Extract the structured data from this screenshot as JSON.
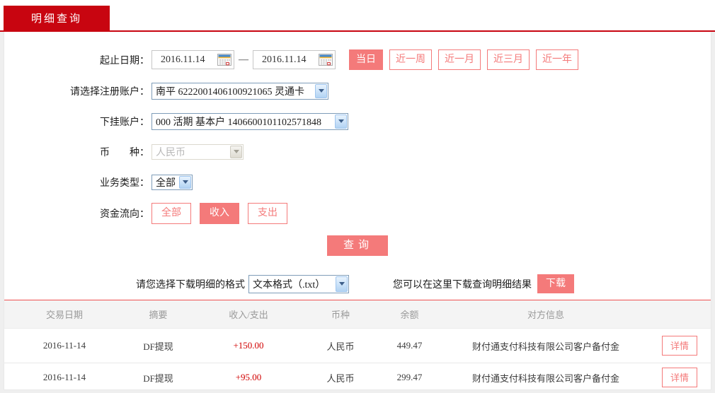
{
  "tab": {
    "label": "明细查询"
  },
  "form": {
    "date_range": {
      "label": "起止日期：",
      "start": "2016.11.14",
      "end": "2016.11.14",
      "separator": "—",
      "quick_buttons": [
        "当日",
        "近一周",
        "近一月",
        "近三月",
        "近一年"
      ]
    },
    "register_account": {
      "label": "请选择注册账户：",
      "value": "南平 6222001406100921065 灵通卡"
    },
    "sub_account": {
      "label": "下挂账户：",
      "value": "000 活期 基本户 1406600101102571848"
    },
    "currency": {
      "label": "币　　种：",
      "value": "人民币"
    },
    "biz_type": {
      "label": "业务类型：",
      "value": "全部"
    },
    "fund_flow": {
      "label": "资金流向：",
      "options": [
        "全部",
        "收入",
        "支出"
      ],
      "selected": "收入"
    },
    "query_button": "查询"
  },
  "download": {
    "format_label": "请您选择下载明细的格式",
    "format_value": "文本格式（.txt）",
    "hint": "您可以在这里下载查询明细结果",
    "button": "下载"
  },
  "table": {
    "headers": [
      "交易日期",
      "摘要",
      "收入/支出",
      "币种",
      "余额",
      "对方信息"
    ],
    "rows": [
      {
        "date": "2016-11-14",
        "summary": "DF提现",
        "amount": "+150.00",
        "currency": "人民币",
        "balance": "449.47",
        "counterparty": "财付通支付科技有限公司客户备付金",
        "action": "详情"
      },
      {
        "date": "2016-11-14",
        "summary": "DF提现",
        "amount": "+95.00",
        "currency": "人民币",
        "balance": "299.47",
        "counterparty": "财付通支付科技有限公司客户备付金",
        "action": "详情"
      }
    ]
  },
  "colors": {
    "brand_red": "#c80510",
    "accent_salmon": "#f47a7a",
    "amount_red": "#d10000",
    "separator_red": "#ef5050"
  }
}
